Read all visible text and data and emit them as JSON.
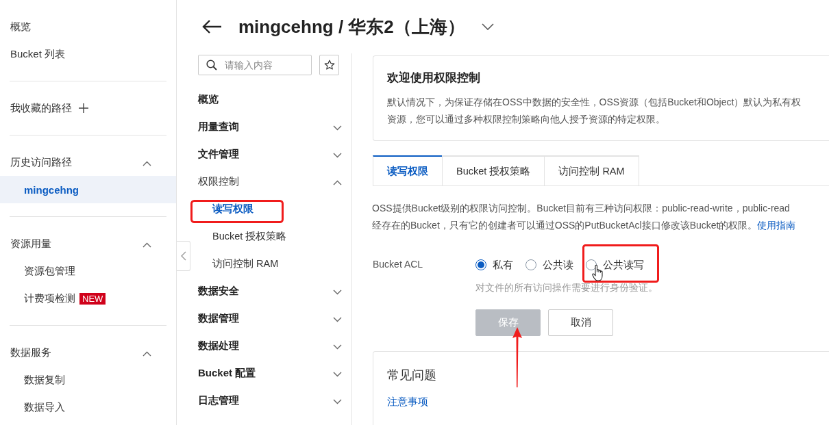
{
  "sidebar": {
    "groups": [
      {
        "kind": "links",
        "items": [
          {
            "label": "概览",
            "selected": false
          },
          {
            "label": "Bucket 列表",
            "selected": false
          }
        ]
      },
      {
        "kind": "add",
        "title": "我收藏的路径"
      },
      {
        "kind": "section",
        "title": "历史访问路径",
        "expanded": true,
        "items": [
          {
            "label": "mingcehng",
            "selected": true
          }
        ]
      },
      {
        "kind": "section",
        "title": "资源用量",
        "expanded": true,
        "items": [
          {
            "label": "资源包管理",
            "selected": false
          },
          {
            "label": "计费项检测",
            "badge": "NEW",
            "selected": false
          }
        ]
      },
      {
        "kind": "section",
        "title": "数据服务",
        "expanded": true,
        "items": [
          {
            "label": "数据复制",
            "selected": false
          },
          {
            "label": "数据导入",
            "selected": false
          }
        ]
      }
    ]
  },
  "header": {
    "title": "mingcehng / 华东2（上海）"
  },
  "nav": {
    "search": {
      "placeholder": "请输入内容"
    },
    "items": [
      {
        "label": "概览"
      },
      {
        "label": "用量查询",
        "expanded": false
      },
      {
        "label": "文件管理",
        "expanded": false
      },
      {
        "label": "权限控制",
        "expanded": true,
        "children": [
          {
            "label": "读写权限",
            "selected": true
          },
          {
            "label": "Bucket 授权策略",
            "selected": false
          },
          {
            "label": "访问控制 RAM",
            "selected": false
          }
        ]
      },
      {
        "label": "数据安全",
        "expanded": false
      },
      {
        "label": "数据管理",
        "expanded": false
      },
      {
        "label": "数据处理",
        "expanded": false
      },
      {
        "label": "Bucket 配置",
        "expanded": false
      },
      {
        "label": "日志管理",
        "expanded": false
      }
    ]
  },
  "intro": {
    "title": "欢迎使用权限控制",
    "lines": [
      "默认情况下，为保证存储在OSS中数据的安全性，OSS资源（包括Bucket和Object）默认为私有权",
      "资源，您可以通过多种权限控制策略向他人授予资源的特定权限。"
    ]
  },
  "tabs": [
    {
      "label": "读写权限",
      "selected": true
    },
    {
      "label": "Bucket 授权策略",
      "selected": false
    },
    {
      "label": "访问控制 RAM",
      "selected": false
    }
  ],
  "description": {
    "lines": [
      "OSS提供Bucket级别的权限访问控制。Bucket目前有三种访问权限：public-read-write，public-read",
      "经存在的Bucket，只有它的创建者可以通过OSS的PutBucketAcl接口修改该Bucket的权限。"
    ],
    "link": "使用指南"
  },
  "acl": {
    "label": "Bucket ACL",
    "options": [
      {
        "label": "私有",
        "selected": true
      },
      {
        "label": "公共读",
        "selected": false
      },
      {
        "label": "公共读写",
        "selected": false
      }
    ],
    "hint": "对文件的所有访问操作需要进行身份验证。"
  },
  "buttons": [
    {
      "label": "保存",
      "kind": "primary",
      "disabled": true
    },
    {
      "label": "取消",
      "kind": "default",
      "disabled": false
    }
  ],
  "faq": {
    "title": "常见问题",
    "links": [
      "注意事项"
    ]
  }
}
